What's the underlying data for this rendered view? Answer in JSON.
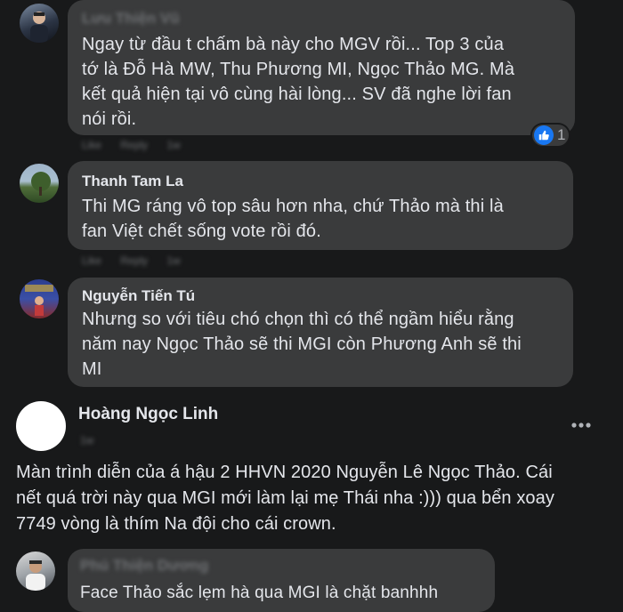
{
  "comments": [
    {
      "author": "Lưu Thiện Vũ",
      "author_blurred": true,
      "text_lines": [
        "Ngay từ đầu t chấm bà này cho MGV rồi... Top 3 của",
        "tớ là Đỗ Hà MW, Thu Phương MI, Ngọc Thảo MG. Mà",
        "kết quả hiện tại vô cùng hài lòng... SV đã nghe lời fan",
        "nói rồi."
      ],
      "meta": "Like Reply 1w",
      "reaction": {
        "icon": "like-icon",
        "count": "1"
      }
    },
    {
      "author": "Thanh Tam La",
      "author_blurred": false,
      "text_lines": [
        "Thi MG ráng vô top sâu hơn nha, chứ Thảo mà thi là",
        "fan Việt chết sống vote rồi đó."
      ],
      "meta": "Like Reply 1w"
    },
    {
      "author": "Nguyễn Tiến Tú",
      "author_blurred": false,
      "text_lines": [
        "Nhưng so với tiêu chó chọn thì có thể ngầm hiểu rằng",
        "năm nay Ngọc Thảo sẽ thi MGI còn Phương Anh sẽ thi",
        "MI"
      ]
    }
  ],
  "post": {
    "author": "Hoàng Ngọc Linh",
    "meta": "1w",
    "more_icon": "more-options-icon",
    "text_lines": [
      "Màn trình diễn của á hậu 2 HHVN 2020 Nguyễn Lê Ngọc Thảo. Cái",
      "nết quá trời này qua MGI mới làm lại mẹ Thái nha :))) qua bển xoay",
      "7749 vòng là thím Na đội cho cái crown."
    ]
  },
  "reply": {
    "author": "Phú Thiện Dương",
    "author_blurred": true,
    "text": "Face Thảo sắc lẹm hà qua MGI là chặt banhhh"
  },
  "colors": {
    "background": "#18191a",
    "bubble": "#3a3b3c",
    "text": "#e4e6eb",
    "like_blue": "#1877f2"
  }
}
